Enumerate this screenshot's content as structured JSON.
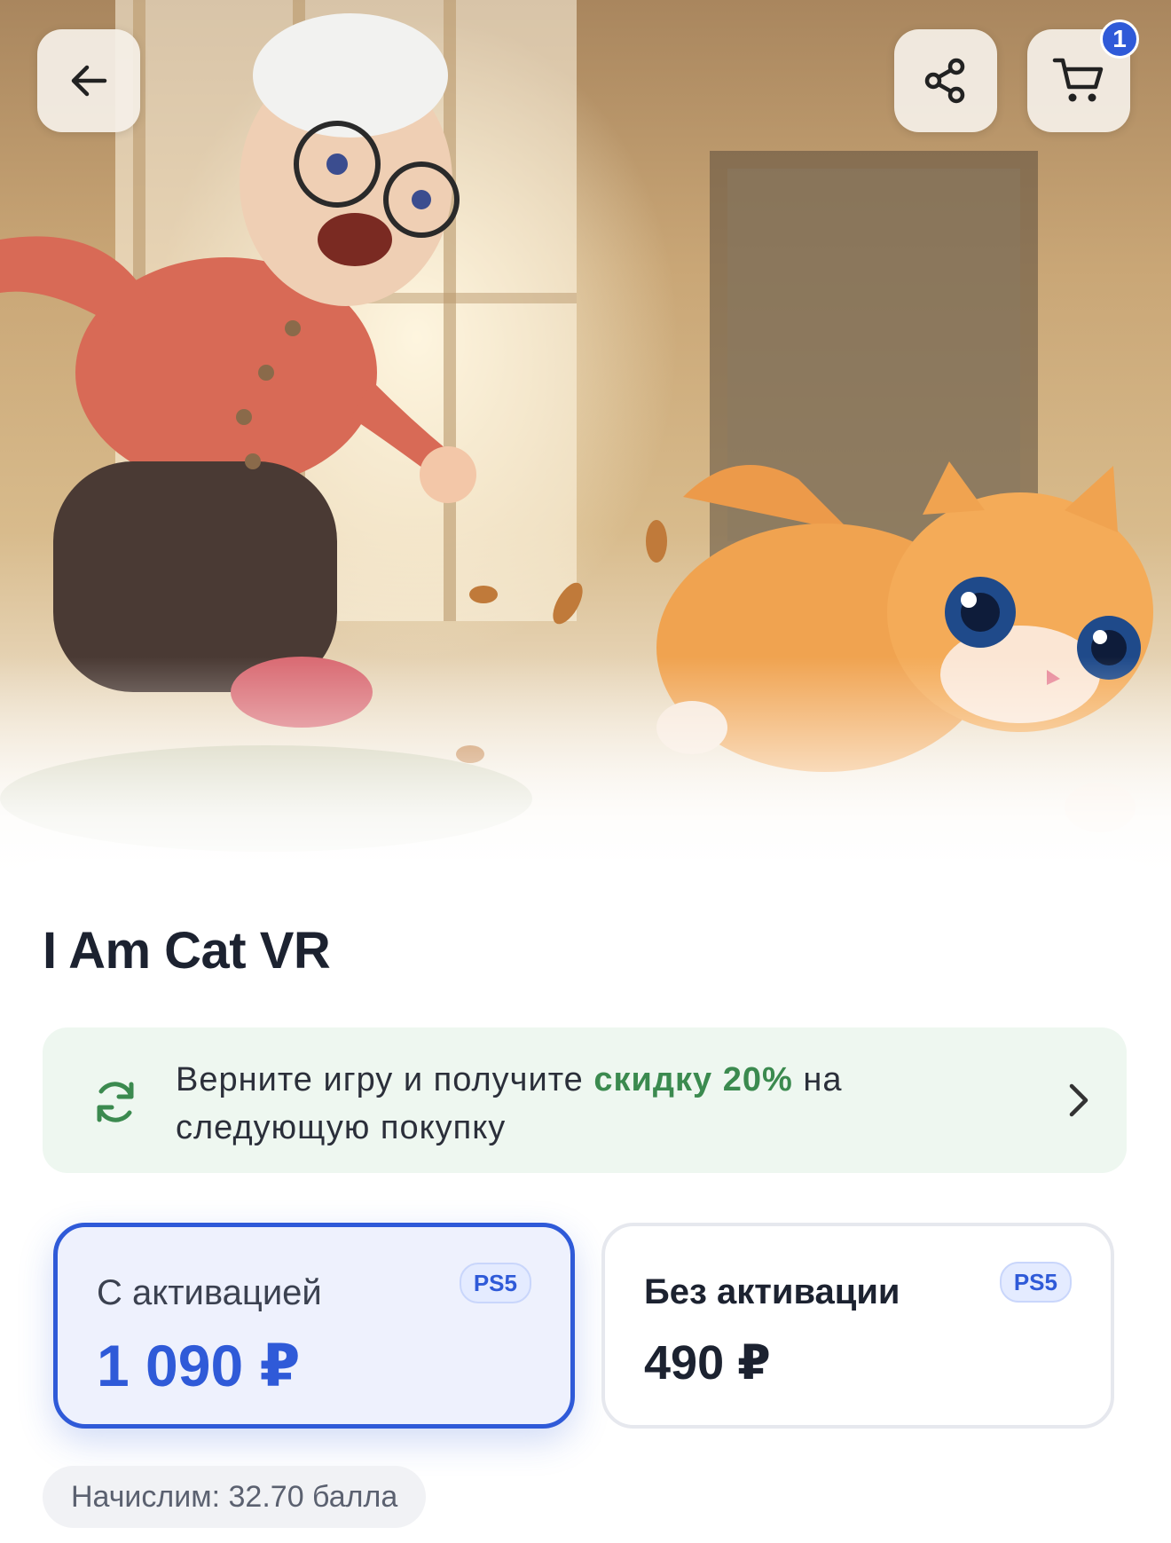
{
  "header": {
    "back_icon": "arrow-left-icon",
    "share_icon": "share-icon",
    "cart_icon": "cart-icon",
    "cart_count": "1"
  },
  "product": {
    "title": "I Am Cat VR"
  },
  "promo": {
    "icon": "refresh-icon",
    "text_before": "Верните игру и получите ",
    "text_accent": "скидку 20%",
    "text_after": " на следующую покупку",
    "accent_color": "#3b8a4f"
  },
  "options": [
    {
      "label": "С активацией",
      "platform": "PS5",
      "price": "1 090 ₽",
      "selected": true
    },
    {
      "label": "Без активации",
      "platform": "PS5",
      "price": "490 ₽",
      "selected": false
    }
  ],
  "points": {
    "text": "Начислим: 32.70 балла"
  },
  "colors": {
    "accent": "#2f5ad8",
    "promo_bg": "#eef7f0",
    "text_dark": "#1c2230"
  }
}
